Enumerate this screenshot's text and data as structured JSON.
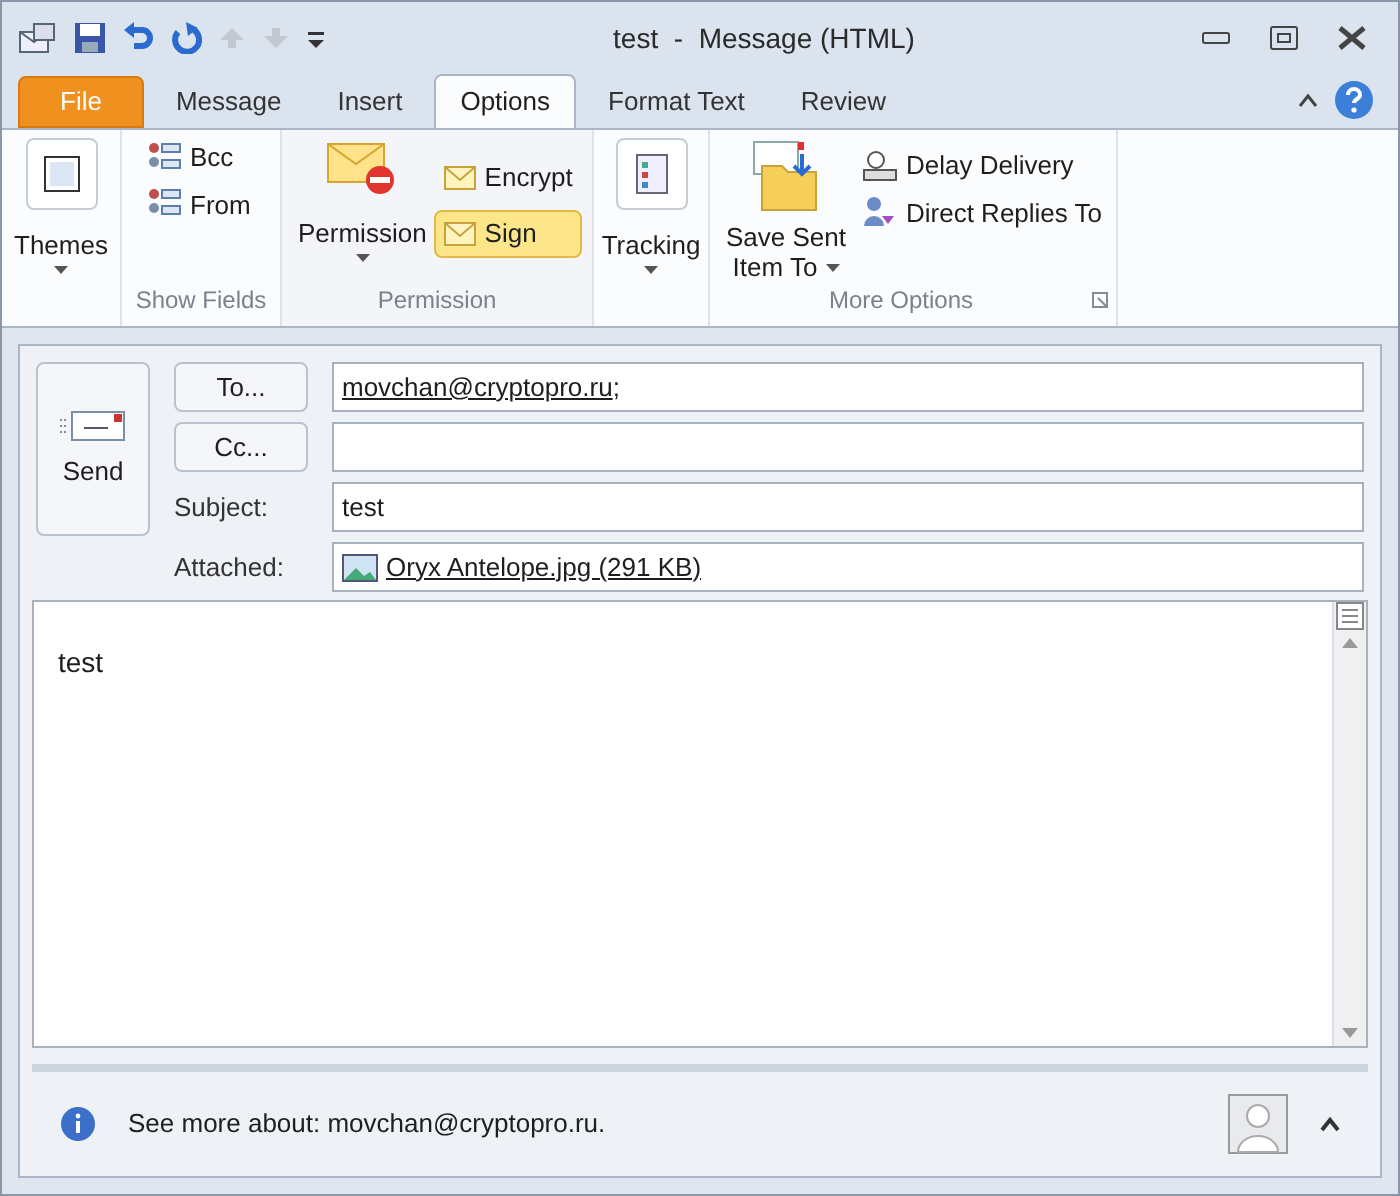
{
  "window": {
    "title": "test  -  Message (HTML)"
  },
  "tabs": [
    {
      "label": "File",
      "kind": "file",
      "selected": false
    },
    {
      "label": "Message",
      "kind": "tab",
      "selected": false
    },
    {
      "label": "Insert",
      "kind": "tab",
      "selected": false
    },
    {
      "label": "Options",
      "kind": "tab",
      "selected": true
    },
    {
      "label": "Format Text",
      "kind": "tab",
      "selected": false
    },
    {
      "label": "Review",
      "kind": "tab",
      "selected": false
    }
  ],
  "ribbon": {
    "themes": {
      "label": "Themes"
    },
    "show_fields": {
      "title": "Show Fields",
      "items": [
        "Bcc",
        "From"
      ]
    },
    "permission": {
      "title": "Permission",
      "label": "Permission",
      "toggles": [
        {
          "label": "Encrypt",
          "on": false
        },
        {
          "label": "Sign",
          "on": true
        }
      ]
    },
    "tracking": {
      "label": "Tracking"
    },
    "more_options": {
      "title": "More Options",
      "save_sent": [
        "Save Sent",
        "Item To"
      ],
      "items": [
        "Delay Delivery",
        "Direct Replies To"
      ]
    }
  },
  "form": {
    "send": "Send",
    "to_button": "To...",
    "to": "movchan@cryptopro.ru",
    "to_suffix": ";",
    "cc_button": "Cc...",
    "subject_label": "Subject:",
    "subject": "test",
    "attached_label": "Attached:",
    "attachment": "Oryx Antelope.jpg (291 KB)"
  },
  "body": {
    "text": "test"
  },
  "people_pane": {
    "text": "See more about: movchan@cryptopro.ru."
  }
}
